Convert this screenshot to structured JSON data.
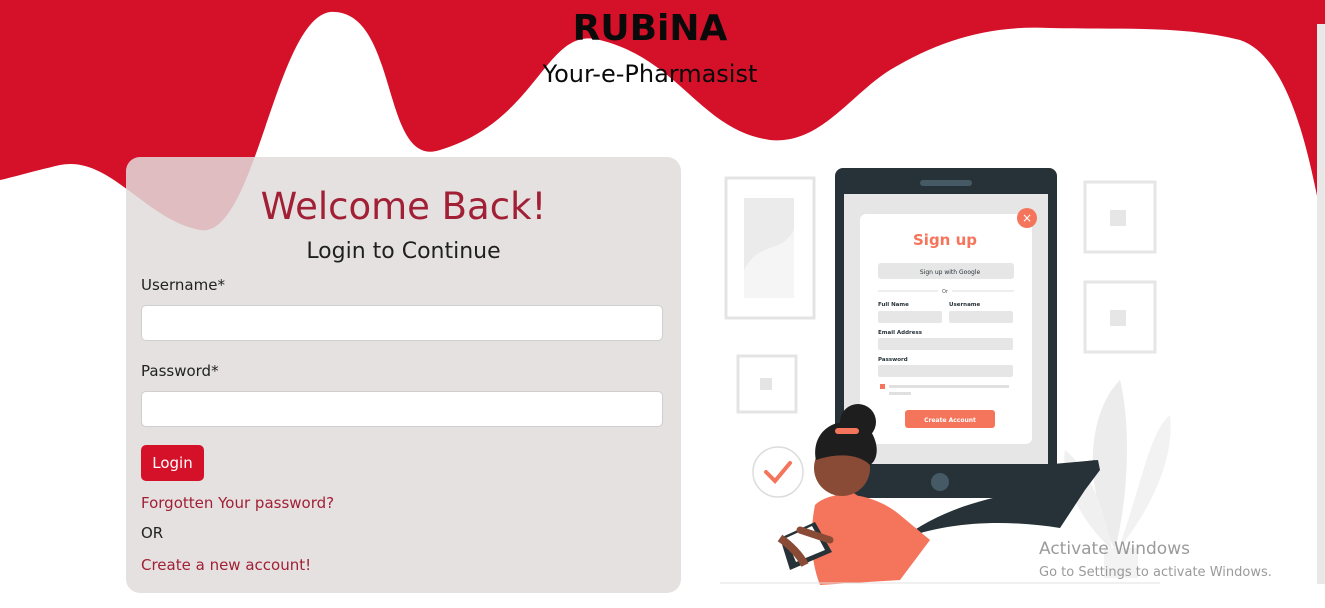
{
  "brand": {
    "title": "RUBiNA",
    "tagline": "Your-e-Pharmasist"
  },
  "login": {
    "heading": "Welcome Back!",
    "subheading": "Login to Continue",
    "username_label": "Username*",
    "username_value": "",
    "password_label": "Password*",
    "password_value": "",
    "login_button": "Login",
    "forgot_link": "Forgotten Your password?",
    "or_text": "OR",
    "create_link": "Create a new account!"
  },
  "illustration": {
    "signup_title": "Sign up",
    "google_button": "Sign up with Google",
    "divider_text": "Or",
    "full_name_label": "Full Name",
    "username_label": "Username",
    "email_label": "Email Address",
    "password_label": "Password",
    "create_button": "Create Account"
  },
  "watermark": {
    "title": "Activate Windows",
    "subtitle": "Go to Settings to activate Windows."
  },
  "colors": {
    "brand_red": "#d41129",
    "heading_red": "#a12035",
    "card_bg": "#e0dcdc",
    "illustration_orange": "#f4755b"
  }
}
